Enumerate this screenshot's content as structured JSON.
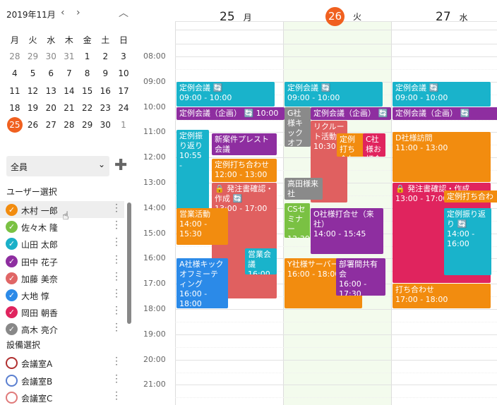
{
  "mini_calendar": {
    "month_title": "2019年11月",
    "prev_icon": "chevron-left",
    "next_icon": "chevron-right",
    "collapse_icon": "chevron-up",
    "weekdays": [
      "月",
      "火",
      "水",
      "木",
      "金",
      "土",
      "日"
    ],
    "weeks": [
      [
        "28",
        "29",
        "30",
        "31",
        "1",
        "2",
        "3"
      ],
      [
        "4",
        "5",
        "6",
        "7",
        "8",
        "9",
        "10"
      ],
      [
        "11",
        "12",
        "13",
        "14",
        "15",
        "16",
        "17"
      ],
      [
        "18",
        "19",
        "20",
        "21",
        "22",
        "23",
        "24"
      ],
      [
        "25",
        "26",
        "27",
        "28",
        "29",
        "30",
        "1"
      ]
    ],
    "today": "25"
  },
  "group_select": {
    "value": "全員"
  },
  "user_section": {
    "title": "ユーザー選択",
    "users": [
      {
        "name": "木村 一郎",
        "color": "#f28c0f"
      },
      {
        "name": "佐々木 隆",
        "color": "#7ac143"
      },
      {
        "name": "山田 太郎",
        "color": "#1ab0c8"
      },
      {
        "name": "田中 花子",
        "color": "#8e2ea0"
      },
      {
        "name": "加藤 美奈",
        "color": "#e06666"
      },
      {
        "name": "大地 惇",
        "color": "#2b8ae8"
      },
      {
        "name": "岡田 朝香",
        "color": "#e0245e"
      },
      {
        "name": "高木 亮介",
        "color": "#888888"
      }
    ]
  },
  "facility_section": {
    "title": "設備選択",
    "rooms": [
      {
        "name": "会議室A",
        "color": "#b03030"
      },
      {
        "name": "会議室B",
        "color": "#5a7fd0"
      },
      {
        "name": "会議室C",
        "color": "#e07a7a"
      }
    ]
  },
  "days": [
    {
      "num": "25",
      "weekday": "月"
    },
    {
      "num": "26",
      "weekday": "火",
      "today": true
    },
    {
      "num": "27",
      "weekday": "水"
    }
  ],
  "times": [
    "08:00",
    "09:00",
    "10:00",
    "11:00",
    "12:00",
    "13:00",
    "14:00",
    "15:00",
    "16:00",
    "17:00",
    "18:00",
    "19:00",
    "20:00",
    "21:00"
  ],
  "colors": {
    "orange": "#f28c0f",
    "cyan": "#19b3cb",
    "purple": "#8e2ea0",
    "red": "#e06060",
    "green": "#7ac143",
    "blue": "#2b8ae8",
    "gray": "#8a8a8a",
    "crimson": "#e0245e",
    "accent": "#f0601f",
    "today_bg": "#f3fbed"
  },
  "events": [
    {
      "day": 0,
      "title": "定例会議 🔄",
      "time": "09:00 - 10:00",
      "color": "cyan"
    },
    {
      "day": 0,
      "title": "定例会議（企画） 🔄 10:00",
      "time": "",
      "color": "purple"
    },
    {
      "day": 0,
      "title": "定例振り返り",
      "time": "10:55 -",
      "color": "cyan"
    },
    {
      "day": 0,
      "title": "新案件プレスト会議",
      "time": "",
      "color": "purple"
    },
    {
      "day": 0,
      "title": "定例打ち合わせ",
      "time": "12:00 - 13:00",
      "color": "orange"
    },
    {
      "day": 0,
      "title": "🔒 発注書確認・作成 🔄",
      "time": "13:00 - 17:00",
      "color": "red"
    },
    {
      "day": 0,
      "title": "営業活動",
      "time": "14:00 - 15:30",
      "color": "orange"
    },
    {
      "day": 0,
      "title": "営業会議",
      "time": "16:00",
      "color": "cyan"
    },
    {
      "day": 0,
      "title": "A社様キックオフミーティング",
      "time": "16:00 - 18:00",
      "color": "blue"
    },
    {
      "day": 1,
      "title": "定例会議 🔄",
      "time": "09:00 - 10:00",
      "color": "cyan"
    },
    {
      "day": 1,
      "title": "G社様キックオフミーティング",
      "time": "",
      "color": "gray"
    },
    {
      "day": 1,
      "title": "定例会議（企画） 🔄 10:00",
      "time": "",
      "color": "purple"
    },
    {
      "day": 1,
      "title": "リクルート活動",
      "time": "10:30",
      "color": "red"
    },
    {
      "day": 1,
      "title": "定例打ち合わせ",
      "time": "",
      "color": "orange"
    },
    {
      "day": 1,
      "title": "C社様お打合せ",
      "time": "",
      "color": "crimson"
    },
    {
      "day": 1,
      "title": "高田様来社",
      "time": "",
      "color": "gray"
    },
    {
      "day": 1,
      "title": "CSセミナー",
      "time": "13:30",
      "color": "green"
    },
    {
      "day": 1,
      "title": "O社様打合せ（来社）",
      "time": "14:00 - 15:45",
      "color": "purple"
    },
    {
      "day": 1,
      "title": "Y社様サーバー",
      "time": "16:00 - 18:00",
      "color": "orange"
    },
    {
      "day": 1,
      "title": "部署間共有会",
      "time": "16:00 - 17:30",
      "color": "purple"
    },
    {
      "day": 2,
      "title": "定例会議 🔄",
      "time": "09:00 - 10:00",
      "color": "cyan"
    },
    {
      "day": 2,
      "title": "定例会議（企画） 🔄",
      "time": "",
      "color": "purple"
    },
    {
      "day": 2,
      "title": "D社様訪問",
      "time": "11:00 - 13:00",
      "color": "orange"
    },
    {
      "day": 2,
      "title": "🔒 発注書確認・作成",
      "time": "13:00 - 17:00",
      "color": "crimson"
    },
    {
      "day": 2,
      "title": "定例打ち合わせ",
      "time": "",
      "color": "orange"
    },
    {
      "day": 2,
      "title": "定例振り返り 🔄",
      "time": "14:00 - 16:00",
      "color": "cyan"
    },
    {
      "day": 2,
      "title": "打ち合わせ",
      "time": "17:00 - 18:00",
      "color": "orange"
    }
  ]
}
